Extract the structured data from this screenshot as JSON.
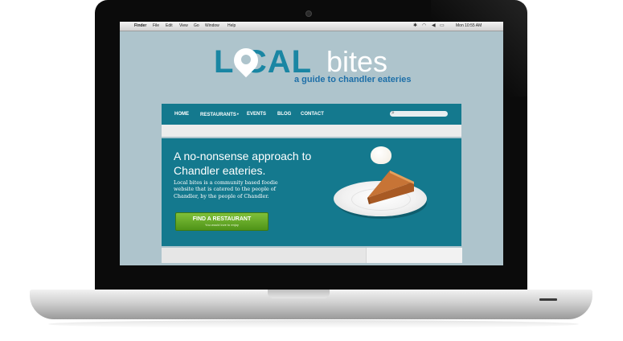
{
  "menubar": {
    "apple": "",
    "items": [
      "Finder",
      "File",
      "Edit",
      "View",
      "Go",
      "Window",
      "Help"
    ],
    "clock": "Mon 10:55 AM"
  },
  "logo": {
    "local_letters": "L  CAL",
    "bites": "bites",
    "tagline": "a guide to chandler eateries"
  },
  "nav": {
    "items": [
      "HOME",
      "RESTAURANTS",
      "EVENTS",
      "BLOG",
      "CONTACT"
    ],
    "dropdown_caret": "▾",
    "search_icon": "search-icon"
  },
  "hero": {
    "title": "A no-nonsense approach to Chandler eateries.",
    "body": "Local bites is a community based foodie website that is catered to the people of Chandler, by the people of Chandler.",
    "cta_label": "FIND A RESTAURANT",
    "cta_sub": "You would love to enjoy"
  },
  "colors": {
    "brand_teal": "#14798e",
    "logo_blue": "#1a86a3",
    "tagline_blue": "#1e6fa8",
    "background": "#aec4cc",
    "cta_green": "#5ea424"
  }
}
